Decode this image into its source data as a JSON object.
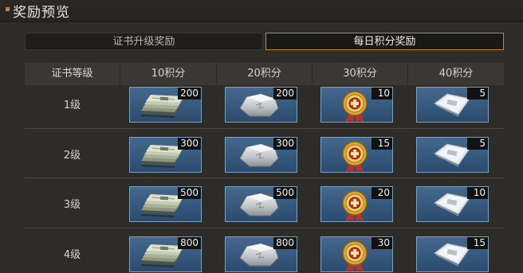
{
  "window": {
    "title": "奖励预览"
  },
  "tabs": [
    {
      "label": "证书升级奖励",
      "active": false
    },
    {
      "label": "每日积分奖励",
      "active": true
    }
  ],
  "table": {
    "headers": [
      "证书等级",
      "10积分",
      "20积分",
      "30积分",
      "40积分"
    ],
    "rows": [
      {
        "level": "1级",
        "rewards": [
          {
            "item": "cash-stack-icon",
            "qty": "200"
          },
          {
            "item": "silver-ore-icon",
            "qty": "200"
          },
          {
            "item": "gold-medal-icon",
            "qty": "10"
          },
          {
            "item": "plastic-bag-icon",
            "qty": "5"
          }
        ]
      },
      {
        "level": "2级",
        "rewards": [
          {
            "item": "cash-stack-icon",
            "qty": "300"
          },
          {
            "item": "silver-ore-icon",
            "qty": "300"
          },
          {
            "item": "gold-medal-icon",
            "qty": "15"
          },
          {
            "item": "plastic-bag-icon",
            "qty": "5"
          }
        ]
      },
      {
        "level": "3级",
        "rewards": [
          {
            "item": "cash-stack-icon",
            "qty": "500"
          },
          {
            "item": "silver-ore-icon",
            "qty": "500"
          },
          {
            "item": "gold-medal-icon",
            "qty": "20"
          },
          {
            "item": "plastic-bag-icon",
            "qty": "10"
          }
        ]
      },
      {
        "level": "4级",
        "rewards": [
          {
            "item": "cash-stack-icon",
            "qty": "800"
          },
          {
            "item": "silver-ore-icon",
            "qty": "800"
          },
          {
            "item": "gold-medal-icon",
            "qty": "30"
          },
          {
            "item": "plastic-bag-icon",
            "qty": "15"
          }
        ]
      }
    ]
  },
  "colors": {
    "accent": "#e07a20",
    "active_tab_border": "#c8862a",
    "reward_tile": "#3f6186"
  }
}
